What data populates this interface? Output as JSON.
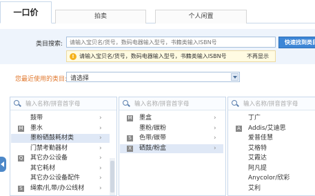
{
  "tabs": [
    {
      "label": "一口价",
      "active": true
    },
    {
      "label": "拍卖",
      "active": false
    },
    {
      "label": "个人闲置",
      "active": false
    }
  ],
  "search": {
    "label": "类目搜索:",
    "placeholder": "请输入宝贝名/货号，数码电器输入型号，书籍类输入ISBN号",
    "button_label": "快速找到类目",
    "tip_text": "请输入宝贝名/货号，数码电器输入型号，书籍类输入ISBN号",
    "tip_close": "不再显示"
  },
  "recent": {
    "label": "您最近使用的类目:",
    "selected": "请选择"
  },
  "panel_search_placeholder": "输入名称/拼音首字母",
  "panel1": {
    "items": [
      {
        "badge": "",
        "label": "鼓带",
        "arrow": true,
        "selected": false
      },
      {
        "badge": "M",
        "label": "墨水",
        "arrow": true,
        "selected": false
      },
      {
        "badge": "",
        "label": "墨粉硒鼓耗材类",
        "arrow": true,
        "selected": true
      },
      {
        "badge": "",
        "label": "门禁考勤器材",
        "arrow": true,
        "selected": false
      },
      {
        "badge": "Q",
        "label": "其它办公设备",
        "arrow": true,
        "selected": false
      },
      {
        "badge": "",
        "label": "其它耗材",
        "arrow": true,
        "selected": false
      },
      {
        "badge": "",
        "label": "其它办公设备配件",
        "arrow": true,
        "selected": false
      },
      {
        "badge": "S",
        "label": "绳索/扎带/办公线材",
        "arrow": true,
        "selected": false
      }
    ]
  },
  "panel2": {
    "items": [
      {
        "badge": "M",
        "label": "墨盒",
        "arrow": true,
        "selected": false
      },
      {
        "badge": "",
        "label": "墨粉/碳粉",
        "arrow": true,
        "selected": false
      },
      {
        "badge": "S",
        "label": "色带/碳带",
        "arrow": true,
        "selected": false
      },
      {
        "badge": "X",
        "label": "硒鼓/粉盒",
        "arrow": true,
        "selected": true
      }
    ]
  },
  "panel3": {
    "items": [
      {
        "badge": "",
        "label": "丁广"
      },
      {
        "badge": "A",
        "label": "Addis/艾迪思"
      },
      {
        "badge": "",
        "label": "爱普佳慧"
      },
      {
        "badge": "",
        "label": "艾格特"
      },
      {
        "badge": "",
        "label": "艾霞达"
      },
      {
        "badge": "",
        "label": "阿凡提"
      },
      {
        "badge": "",
        "label": "Anycolor/欣彩"
      },
      {
        "badge": "",
        "label": "艾利"
      }
    ]
  }
}
